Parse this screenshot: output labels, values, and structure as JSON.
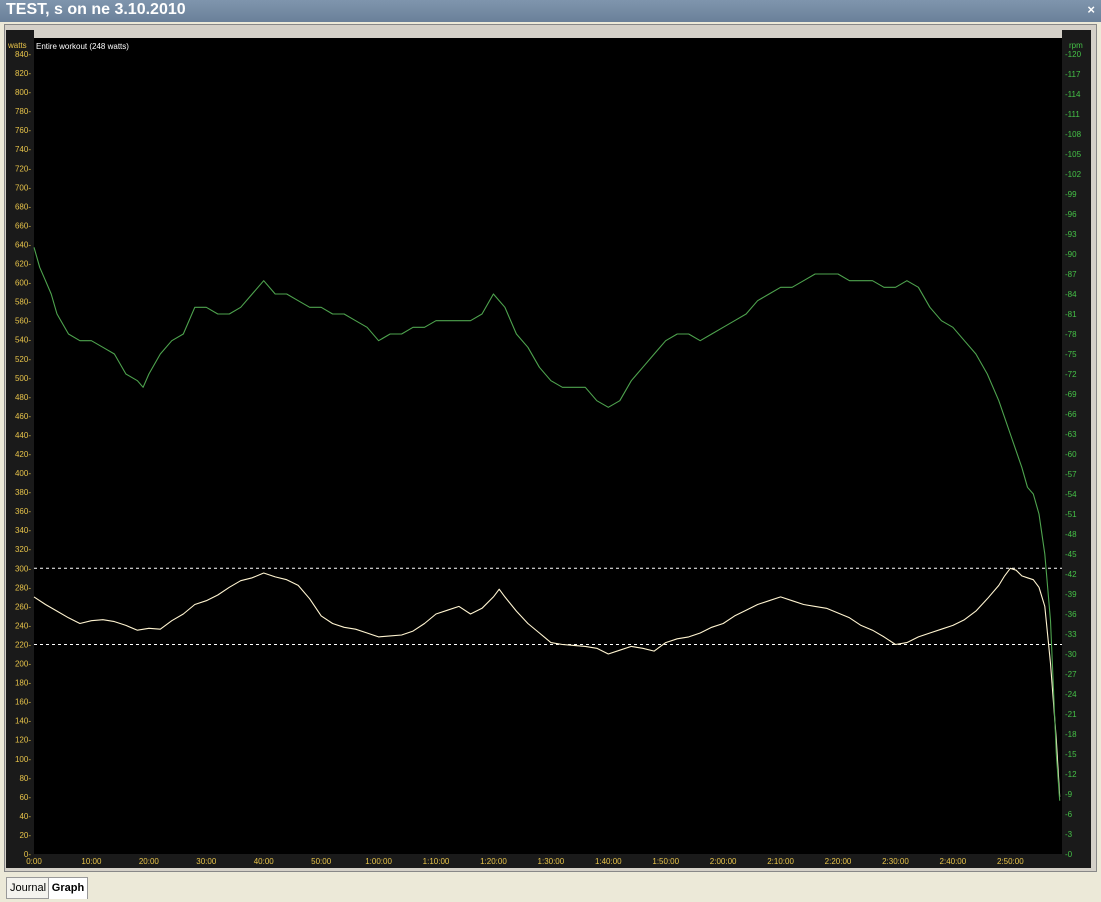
{
  "window": {
    "title": "TEST, s on ne 3.10.2010",
    "close_glyph": "×"
  },
  "tabs": [
    {
      "label": "Journal",
      "active": false
    },
    {
      "label": "Graph",
      "active": true
    }
  ],
  "chart_data": {
    "type": "line",
    "subtitle": "Entire workout (248 watts)",
    "left_axis": {
      "label": "watts",
      "min": 0,
      "max": 840,
      "step": 20,
      "color": "#e8c44a"
    },
    "right_axis": {
      "label": "rpm",
      "min": 0,
      "max": 120,
      "step": 3,
      "color": "#45c247"
    },
    "x_axis": {
      "min": 0,
      "max": 179,
      "ticks": [
        {
          "v": 0,
          "label": "0:00"
        },
        {
          "v": 10,
          "label": "10:00"
        },
        {
          "v": 20,
          "label": "20:00"
        },
        {
          "v": 30,
          "label": "30:00"
        },
        {
          "v": 40,
          "label": "40:00"
        },
        {
          "v": 50,
          "label": "50:00"
        },
        {
          "v": 60,
          "label": "1:00:00"
        },
        {
          "v": 70,
          "label": "1:10:00"
        },
        {
          "v": 80,
          "label": "1:20:00"
        },
        {
          "v": 90,
          "label": "1:30:00"
        },
        {
          "v": 100,
          "label": "1:40:00"
        },
        {
          "v": 110,
          "label": "1:50:00"
        },
        {
          "v": 120,
          "label": "2:00:00"
        },
        {
          "v": 130,
          "label": "2:10:00"
        },
        {
          "v": 140,
          "label": "2:20:00"
        },
        {
          "v": 150,
          "label": "2:30:00"
        },
        {
          "v": 160,
          "label": "2:40:00"
        },
        {
          "v": 170,
          "label": "2:50:00"
        }
      ]
    },
    "reference_lines_watts": [
      300,
      220
    ],
    "series": [
      {
        "name": "watts",
        "axis": "left",
        "color": "#fff4d0",
        "points": [
          [
            0,
            270
          ],
          [
            2,
            262
          ],
          [
            4,
            255
          ],
          [
            6,
            248
          ],
          [
            8,
            242
          ],
          [
            10,
            245
          ],
          [
            12,
            246
          ],
          [
            14,
            244
          ],
          [
            16,
            240
          ],
          [
            18,
            235
          ],
          [
            20,
            237
          ],
          [
            22,
            236
          ],
          [
            24,
            245
          ],
          [
            26,
            252
          ],
          [
            28,
            262
          ],
          [
            30,
            266
          ],
          [
            32,
            272
          ],
          [
            34,
            280
          ],
          [
            36,
            287
          ],
          [
            38,
            290
          ],
          [
            40,
            295
          ],
          [
            42,
            291
          ],
          [
            44,
            288
          ],
          [
            46,
            282
          ],
          [
            48,
            268
          ],
          [
            50,
            250
          ],
          [
            52,
            242
          ],
          [
            54,
            238
          ],
          [
            56,
            236
          ],
          [
            58,
            232
          ],
          [
            60,
            228
          ],
          [
            62,
            229
          ],
          [
            64,
            230
          ],
          [
            66,
            234
          ],
          [
            68,
            242
          ],
          [
            70,
            252
          ],
          [
            72,
            256
          ],
          [
            74,
            260
          ],
          [
            76,
            252
          ],
          [
            78,
            258
          ],
          [
            80,
            270
          ],
          [
            81,
            278
          ],
          [
            82,
            270
          ],
          [
            84,
            255
          ],
          [
            86,
            242
          ],
          [
            88,
            232
          ],
          [
            90,
            222
          ],
          [
            92,
            220
          ],
          [
            94,
            219
          ],
          [
            96,
            218
          ],
          [
            98,
            216
          ],
          [
            100,
            210
          ],
          [
            102,
            214
          ],
          [
            104,
            218
          ],
          [
            106,
            216
          ],
          [
            108,
            213
          ],
          [
            110,
            222
          ],
          [
            112,
            226
          ],
          [
            114,
            228
          ],
          [
            116,
            232
          ],
          [
            118,
            238
          ],
          [
            120,
            242
          ],
          [
            122,
            250
          ],
          [
            124,
            256
          ],
          [
            126,
            262
          ],
          [
            128,
            266
          ],
          [
            130,
            270
          ],
          [
            132,
            266
          ],
          [
            134,
            262
          ],
          [
            136,
            260
          ],
          [
            138,
            258
          ],
          [
            140,
            253
          ],
          [
            142,
            248
          ],
          [
            144,
            240
          ],
          [
            146,
            235
          ],
          [
            148,
            228
          ],
          [
            150,
            220
          ],
          [
            152,
            222
          ],
          [
            154,
            228
          ],
          [
            156,
            232
          ],
          [
            158,
            236
          ],
          [
            160,
            240
          ],
          [
            162,
            246
          ],
          [
            164,
            255
          ],
          [
            166,
            268
          ],
          [
            168,
            282
          ],
          [
            169,
            292
          ],
          [
            170,
            300
          ],
          [
            171,
            298
          ],
          [
            172,
            292
          ],
          [
            173,
            290
          ],
          [
            174,
            288
          ],
          [
            175,
            280
          ],
          [
            176,
            260
          ],
          [
            177,
            200
          ],
          [
            178,
            120
          ],
          [
            178.6,
            60
          ]
        ]
      },
      {
        "name": "rpm",
        "axis": "right",
        "color": "#4ea34e",
        "points": [
          [
            0,
            91
          ],
          [
            1,
            88
          ],
          [
            2,
            86
          ],
          [
            3,
            84
          ],
          [
            4,
            81
          ],
          [
            6,
            78
          ],
          [
            8,
            77
          ],
          [
            10,
            77
          ],
          [
            12,
            76
          ],
          [
            14,
            75
          ],
          [
            16,
            72
          ],
          [
            18,
            71
          ],
          [
            19,
            70
          ],
          [
            20,
            72
          ],
          [
            22,
            75
          ],
          [
            24,
            77
          ],
          [
            26,
            78
          ],
          [
            28,
            82
          ],
          [
            30,
            82
          ],
          [
            32,
            81
          ],
          [
            34,
            81
          ],
          [
            36,
            82
          ],
          [
            38,
            84
          ],
          [
            40,
            86
          ],
          [
            42,
            84
          ],
          [
            44,
            84
          ],
          [
            46,
            83
          ],
          [
            48,
            82
          ],
          [
            50,
            82
          ],
          [
            52,
            81
          ],
          [
            54,
            81
          ],
          [
            56,
            80
          ],
          [
            58,
            79
          ],
          [
            60,
            77
          ],
          [
            62,
            78
          ],
          [
            64,
            78
          ],
          [
            66,
            79
          ],
          [
            68,
            79
          ],
          [
            70,
            80
          ],
          [
            72,
            80
          ],
          [
            74,
            80
          ],
          [
            76,
            80
          ],
          [
            78,
            81
          ],
          [
            80,
            84
          ],
          [
            82,
            82
          ],
          [
            84,
            78
          ],
          [
            86,
            76
          ],
          [
            88,
            73
          ],
          [
            90,
            71
          ],
          [
            92,
            70
          ],
          [
            94,
            70
          ],
          [
            96,
            70
          ],
          [
            98,
            68
          ],
          [
            100,
            67
          ],
          [
            102,
            68
          ],
          [
            104,
            71
          ],
          [
            106,
            73
          ],
          [
            108,
            75
          ],
          [
            110,
            77
          ],
          [
            112,
            78
          ],
          [
            114,
            78
          ],
          [
            116,
            77
          ],
          [
            118,
            78
          ],
          [
            120,
            79
          ],
          [
            122,
            80
          ],
          [
            124,
            81
          ],
          [
            126,
            83
          ],
          [
            128,
            84
          ],
          [
            130,
            85
          ],
          [
            132,
            85
          ],
          [
            134,
            86
          ],
          [
            136,
            87
          ],
          [
            138,
            87
          ],
          [
            140,
            87
          ],
          [
            142,
            86
          ],
          [
            144,
            86
          ],
          [
            146,
            86
          ],
          [
            148,
            85
          ],
          [
            150,
            85
          ],
          [
            152,
            86
          ],
          [
            154,
            85
          ],
          [
            156,
            82
          ],
          [
            158,
            80
          ],
          [
            160,
            79
          ],
          [
            162,
            77
          ],
          [
            164,
            75
          ],
          [
            166,
            72
          ],
          [
            168,
            68
          ],
          [
            170,
            63
          ],
          [
            172,
            58
          ],
          [
            173,
            55
          ],
          [
            174,
            54
          ],
          [
            175,
            51
          ],
          [
            176,
            45
          ],
          [
            177,
            35
          ],
          [
            178,
            15
          ],
          [
            178.6,
            8
          ]
        ]
      }
    ]
  }
}
